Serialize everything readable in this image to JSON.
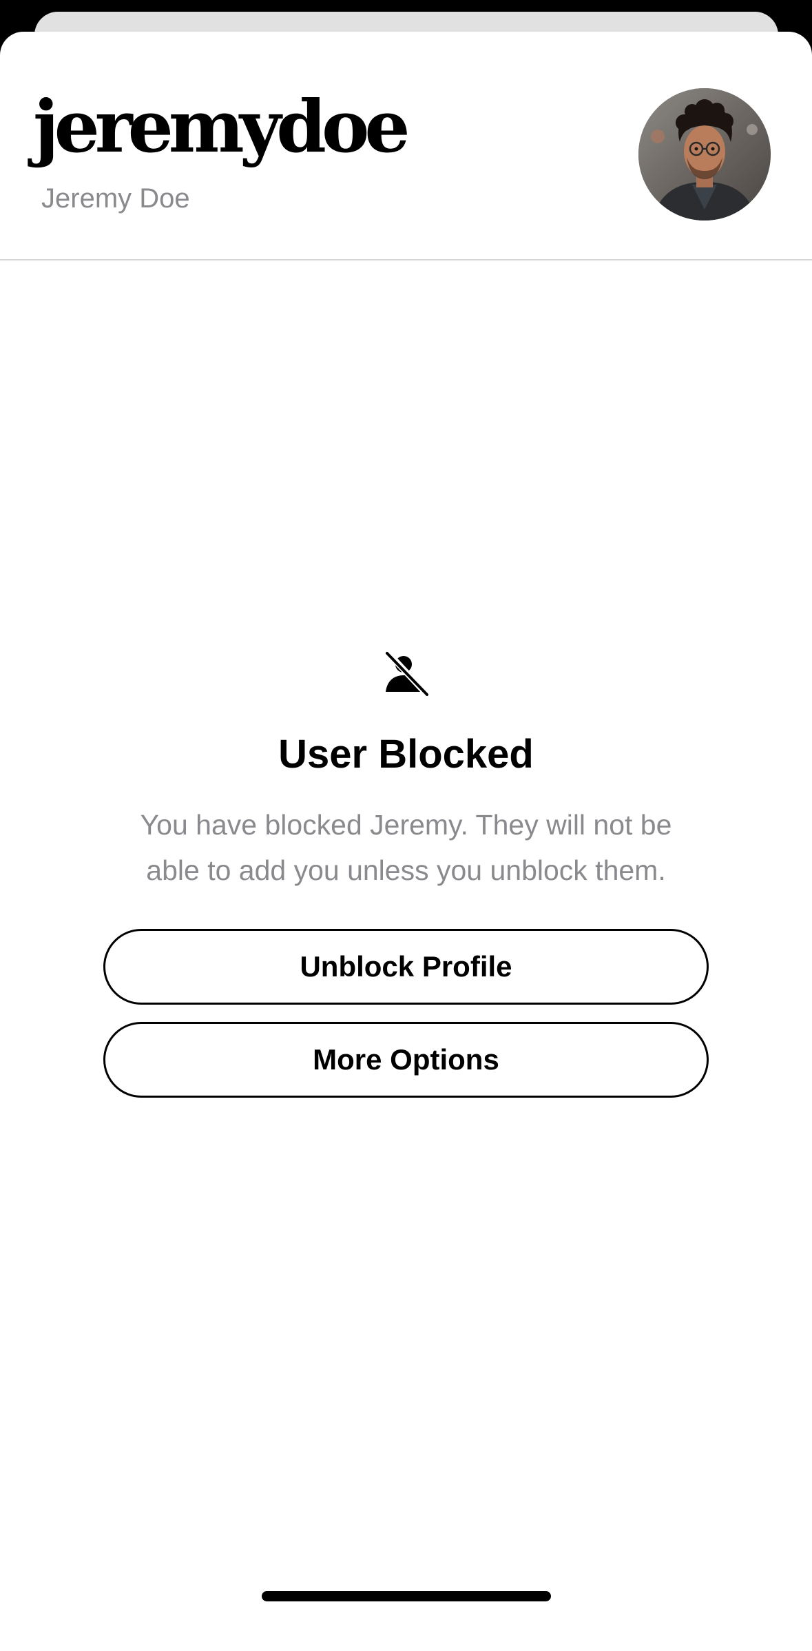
{
  "profile": {
    "username": "jeremydoe",
    "display_name": "Jeremy Doe",
    "avatar_icon": "profile-photo"
  },
  "blocked_state": {
    "icon": "person-slash-icon",
    "title": "User Blocked",
    "message": "You have blocked Jeremy. They will not be able to add you unless you unblock them."
  },
  "actions": {
    "unblock_label": "Unblock Profile",
    "more_options_label": "More Options"
  },
  "colors": {
    "background": "#ffffff",
    "primary_text": "#000000",
    "secondary_text": "#8a8a8e",
    "divider": "#d6d6d6"
  }
}
